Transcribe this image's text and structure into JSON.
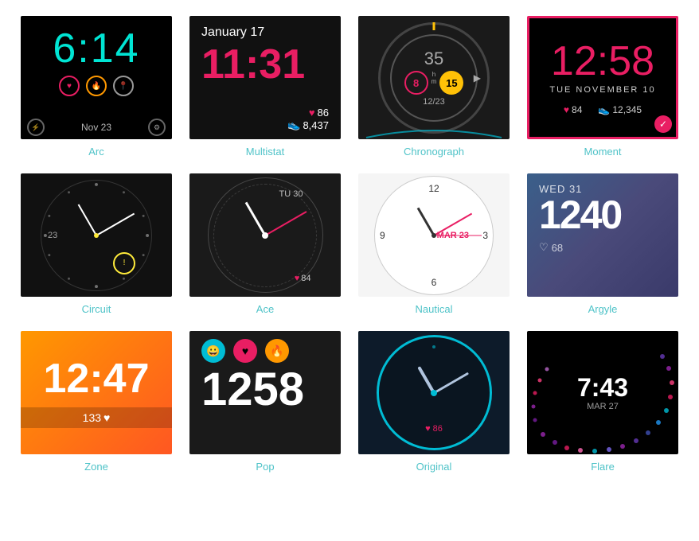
{
  "faces": [
    {
      "id": "arc",
      "label": "Arc",
      "time": "6:14",
      "date": "Nov 23",
      "selected": false
    },
    {
      "id": "multistat",
      "label": "Multistat",
      "time": "11:31",
      "date": "January 17",
      "heart": "86",
      "steps": "8,437",
      "selected": false
    },
    {
      "id": "chronograph",
      "label": "Chronograph",
      "big_num": "35",
      "h_val": "8",
      "m_val": "15",
      "sub_date": "12/23",
      "selected": false
    },
    {
      "id": "moment",
      "label": "Moment",
      "time": "12:58",
      "date": "TUE NOVEMBER 10",
      "heart": "84",
      "steps": "12,345",
      "selected": true
    },
    {
      "id": "circuit",
      "label": "Circuit",
      "num": "23",
      "badge": "!",
      "selected": false
    },
    {
      "id": "ace",
      "label": "Ace",
      "date_str": "TU 30",
      "heart": "84",
      "selected": false
    },
    {
      "id": "nautical",
      "label": "Nautical",
      "date_badge": "MAR 23",
      "selected": false
    },
    {
      "id": "argyle",
      "label": "Argyle",
      "day": "WED 31",
      "time": "1240",
      "heart": "68",
      "selected": false
    },
    {
      "id": "zone",
      "label": "Zone",
      "time": "12:47",
      "steps": "133",
      "selected": false
    },
    {
      "id": "pop",
      "label": "Pop",
      "time": "1258",
      "selected": false
    },
    {
      "id": "original",
      "label": "Original",
      "heart": "86",
      "selected": false
    },
    {
      "id": "flare",
      "label": "Flare",
      "time": "7:43",
      "date": "MAR 27",
      "selected": false
    }
  ]
}
